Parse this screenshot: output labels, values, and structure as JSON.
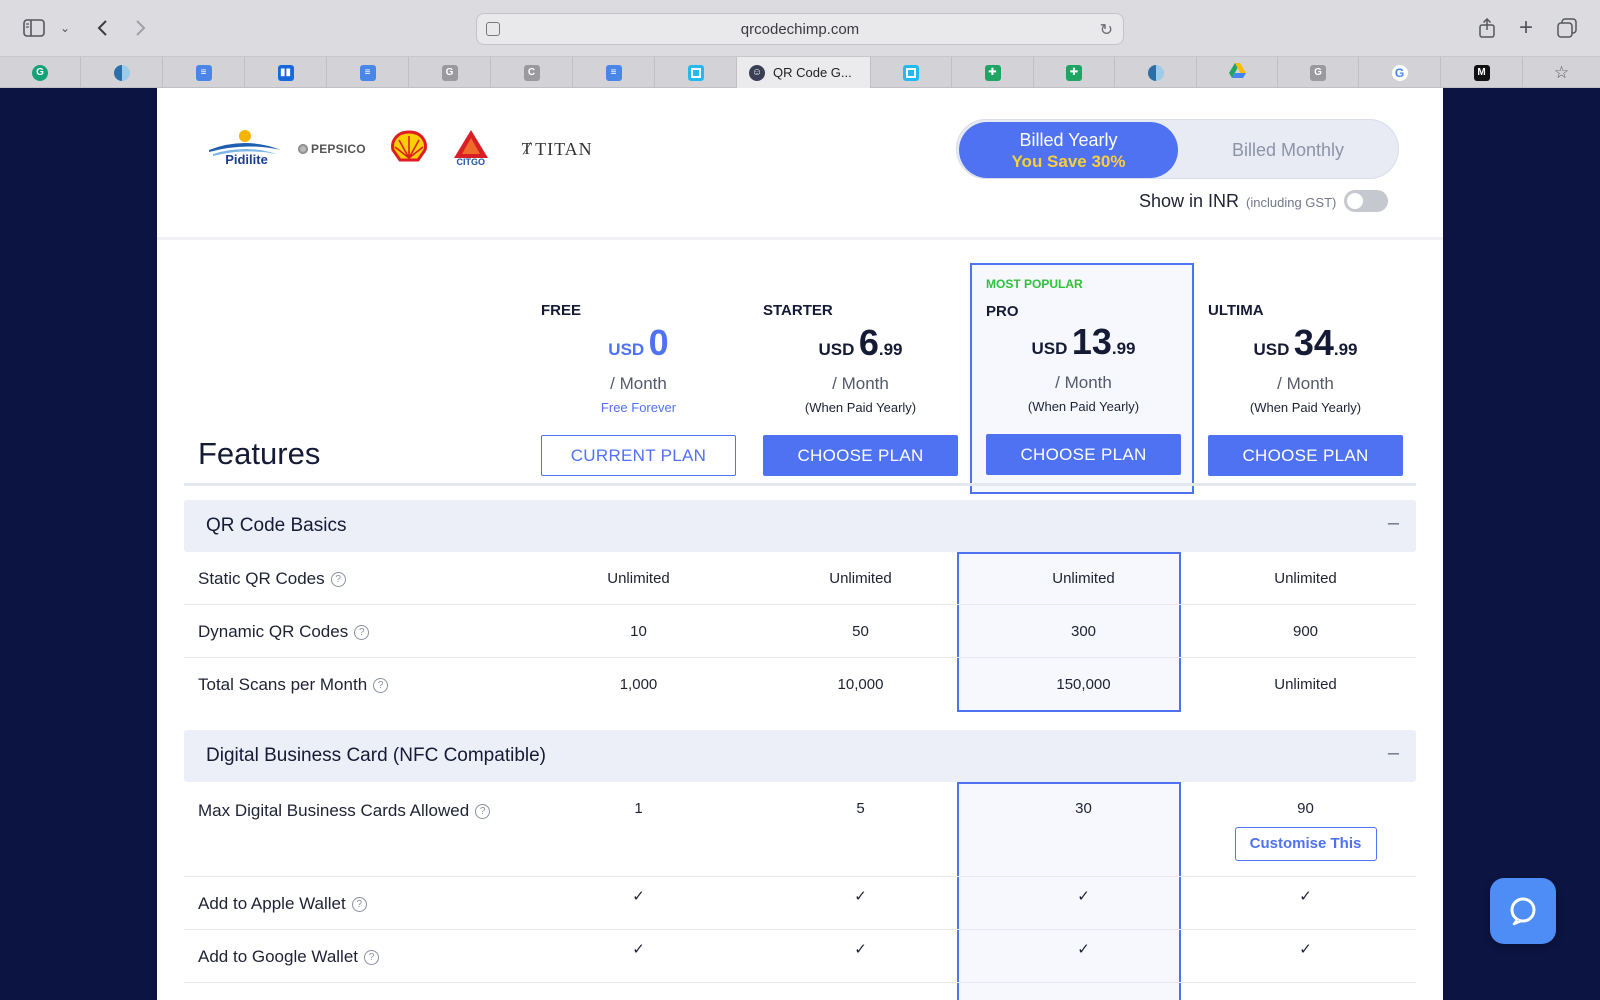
{
  "browser": {
    "url": "qrcodechimp.com",
    "active_tab_title": "QR Code G...",
    "tab_icons": [
      "grammarly-icon",
      "site-icon",
      "docs-icon",
      "trello-icon",
      "docs-icon",
      "g-icon",
      "c-icon",
      "docs-icon",
      "app-icon",
      "qr-chimp-icon",
      "app-icon",
      "sheets-icon",
      "sheets-icon",
      "site-icon",
      "drive-icon",
      "g-icon",
      "google-icon",
      "medium-icon"
    ]
  },
  "brands": {
    "pidilite": "Pidilite",
    "pepsico": "PEPSICO",
    "citgo": "CITGO",
    "titan": "TITAN"
  },
  "billing": {
    "yearly_label": "Billed Yearly",
    "yearly_savings": "You Save 30%",
    "monthly_label": "Billed Monthly",
    "inr_label": "Show in INR",
    "inr_sub": "(including GST)",
    "inr_enabled": false
  },
  "pricing": {
    "features_title": "Features",
    "currency": "USD",
    "per_month": "/ Month",
    "most_popular": "MOST POPULAR",
    "plans": [
      {
        "name": "FREE",
        "amount": "0",
        "cents": "",
        "note": "Free Forever",
        "button": "CURRENT PLAN"
      },
      {
        "name": "STARTER",
        "amount": "6",
        "cents": ".99",
        "note": "(When Paid Yearly)",
        "button": "CHOOSE PLAN"
      },
      {
        "name": "PRO",
        "amount": "13",
        "cents": ".99",
        "note": "(When Paid Yearly)",
        "button": "CHOOSE PLAN"
      },
      {
        "name": "ULTIMA",
        "amount": "34",
        "cents": ".99",
        "note": "(When Paid Yearly)",
        "button": "CHOOSE PLAN"
      }
    ]
  },
  "sections": [
    {
      "title": "QR Code Basics",
      "toggle": "–",
      "rows": [
        {
          "name": "Static QR Codes",
          "values": [
            "Unlimited",
            "Unlimited",
            "Unlimited",
            "Unlimited"
          ]
        },
        {
          "name": "Dynamic QR Codes",
          "values": [
            "10",
            "50",
            "300",
            "900"
          ]
        },
        {
          "name": "Total Scans per Month",
          "values": [
            "1,000",
            "10,000",
            "150,000",
            "Unlimited"
          ]
        }
      ]
    },
    {
      "title": "Digital Business Card (NFC Compatible)",
      "toggle": "–",
      "rows": [
        {
          "name": "Max Digital Business Cards Allowed",
          "values": [
            "1",
            "5",
            "30",
            "90"
          ],
          "extra_button": "Customise This"
        },
        {
          "name": "Add to Apple Wallet",
          "values": [
            "✓",
            "✓",
            "✓",
            "✓"
          ]
        },
        {
          "name": "Add to Google Wallet",
          "values": [
            "✓",
            "✓",
            "✓",
            "✓"
          ]
        }
      ]
    }
  ],
  "colors": {
    "accent": "#4f72f3",
    "page_background": "#0c1442",
    "savings": "#f7cf3b",
    "most_popular": "#2fc13b"
  }
}
